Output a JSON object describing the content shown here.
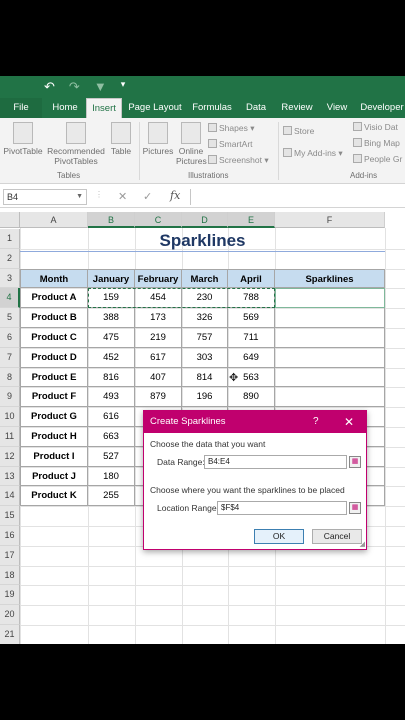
{
  "qat": {
    "undo_icon": "undo-icon",
    "redo_icon": "redo-icon",
    "filter_icon": "filter-icon",
    "customize_icon": "customize-icon"
  },
  "tabs": [
    "File",
    "Home",
    "Insert",
    "Page Layout",
    "Formulas",
    "Data",
    "Review",
    "View",
    "Developer"
  ],
  "active_tab": "Insert",
  "ribbon": {
    "pivottable": "PivotTable",
    "recommended": "Recommended",
    "pivottables": "PivotTables",
    "table": "Table",
    "tables_group": "Tables",
    "pictures": "Pictures",
    "online": "Online",
    "pictures2": "Pictures",
    "shapes": "Shapes",
    "smartart": "SmartArt",
    "screenshot": "Screenshot",
    "illustrations_group": "Illustrations",
    "store": "Store",
    "my_addins": "My Add-ins",
    "visio": "Visio Dat",
    "bing": "Bing Map",
    "people": "People Gr",
    "addins_group": "Add-ins"
  },
  "formula_bar": {
    "name_box": "B4",
    "cancel": "✕",
    "enter": "✓",
    "fx": "fx",
    "value": ""
  },
  "columns": [
    "A",
    "B",
    "C",
    "D",
    "E",
    "F"
  ],
  "rows": [
    "1",
    "2",
    "3",
    "4",
    "5",
    "6",
    "7",
    "8",
    "9",
    "10",
    "11",
    "12",
    "13",
    "14",
    "15",
    "16",
    "17",
    "18",
    "19",
    "20",
    "21"
  ],
  "sheet": {
    "title": "Sparklines",
    "headers": [
      "Month",
      "January",
      "February",
      "March",
      "April",
      "Sparklines"
    ],
    "data": [
      [
        "Product A",
        "159",
        "454",
        "230",
        "788"
      ],
      [
        "Product B",
        "388",
        "173",
        "326",
        "569"
      ],
      [
        "Product C",
        "475",
        "219",
        "757",
        "711"
      ],
      [
        "Product D",
        "452",
        "617",
        "303",
        "649"
      ],
      [
        "Product E",
        "816",
        "407",
        "814",
        "563"
      ],
      [
        "Product F",
        "493",
        "879",
        "196",
        "890"
      ],
      [
        "Product G",
        "616",
        "",
        "",
        ""
      ],
      [
        "Product H",
        "663",
        "",
        "",
        ""
      ],
      [
        "Product I",
        "527",
        "",
        "",
        ""
      ],
      [
        "Product J",
        "180",
        "",
        "",
        ""
      ],
      [
        "Product K",
        "255",
        "",
        "",
        ""
      ]
    ]
  },
  "dialog": {
    "title": "Create Sparklines",
    "help": "?",
    "close": "✕",
    "section1": "Choose the data that you want",
    "data_range_label": "Data Range:",
    "data_range_value": "B4:E4",
    "section2": "Choose where you want the sparklines to be placed",
    "location_label": "Location Range:",
    "location_value": "$F$4",
    "ok": "OK",
    "cancel": "Cancel"
  },
  "colors": {
    "excel_green": "#217346",
    "dialog_accent": "#c0006e",
    "header_fill": "#c6dcef",
    "title_color": "#1f3864"
  }
}
